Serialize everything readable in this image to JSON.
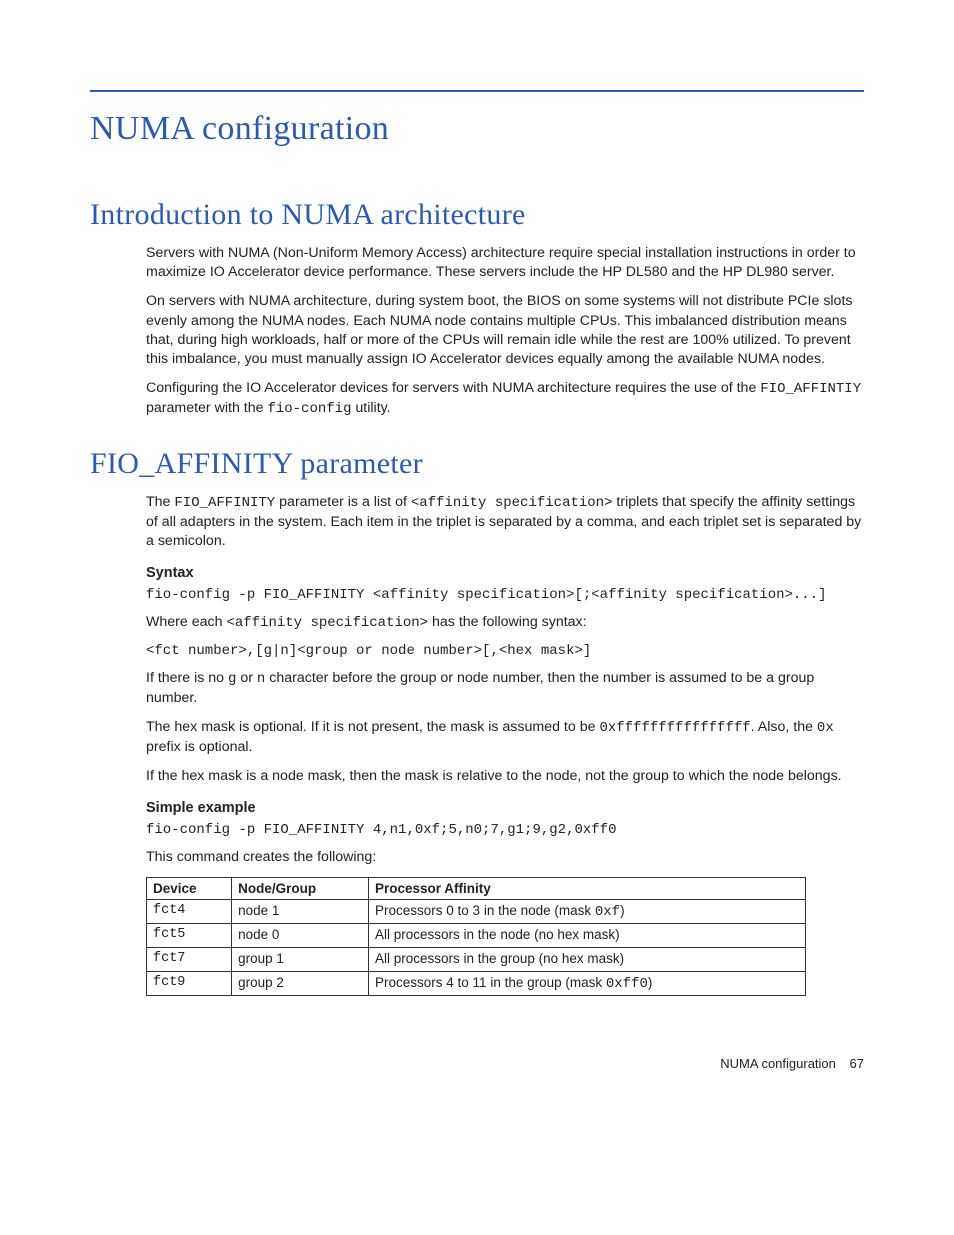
{
  "title": "NUMA configuration",
  "section1": {
    "heading": "Introduction to NUMA architecture",
    "para1": "Servers with NUMA (Non-Uniform Memory Access) architecture require special installation instructions in order to maximize IO Accelerator device performance. These servers include the HP DL580 and the HP DL980 server.",
    "para2": "On servers with NUMA architecture, during system boot, the BIOS on some systems will not distribute PCIe slots evenly among the NUMA nodes. Each NUMA node contains multiple CPUs. This imbalanced distribution means that, during high workloads, half or more of the CPUs will remain idle while the rest are 100% utilized. To prevent this imbalance, you must manually assign IO Accelerator devices equally among the available NUMA nodes.",
    "para3_a": "Configuring the IO Accelerator devices for servers with NUMA architecture requires the use of the ",
    "para3_code1": "FIO_AFFINTIY",
    "para3_b": " parameter with the ",
    "para3_code2": "fio-config",
    "para3_c": " utility."
  },
  "section2": {
    "heading": "FIO_AFFINITY parameter",
    "para1_a": "The ",
    "para1_code1": "FIO_AFFINITY",
    "para1_b": " parameter is a list of ",
    "para1_code2": "<affinity specification>",
    "para1_c": " triplets that specify the affinity settings of all adapters in the system. Each item in the triplet is separated by a comma, and each triplet set is separated by a semicolon.",
    "syntax_label": "Syntax",
    "syntax_block": "fio-config -p FIO_AFFINITY <affinity specification>[;<affinity specification>...]",
    "where_a": "Where each ",
    "where_code": "<affinity specification>",
    "where_b": " has the following syntax:",
    "where_syntax": "<fct number>,[g|n]<group or node number>[,<hex mask>]",
    "gn_a": "If there is no ",
    "gn_code1": "g",
    "gn_b": " or ",
    "gn_code2": "n",
    "gn_c": " character before the group or node number, then the number is assumed to be a group number.",
    "hex_a": "The hex mask is optional. If it is not present, the mask is assumed to be ",
    "hex_code1": "0xffffffffffffffff",
    "hex_b": ". Also, the ",
    "hex_code2": "0x",
    "hex_c": " prefix is optional.",
    "nodemask": "If the hex mask is a node mask, then the mask is relative to the node, not the group to which the node belongs.",
    "example_label": "Simple example",
    "example_block": "fio-config -p FIO_AFFINITY 4,n1,0xf;5,n0;7,g1;9,g2,0xff0",
    "example_caption": "This command creates the following:",
    "table": {
      "headers": [
        "Device",
        "Node/Group",
        "Processor Affinity"
      ],
      "rows": [
        {
          "device": "fct4",
          "group": "node 1",
          "aff_a": "Processors 0 to 3 in the node (mask ",
          "aff_code": "0xf",
          "aff_b": ")"
        },
        {
          "device": "fct5",
          "group": "node 0",
          "aff_a": "All processors in the node (no hex mask)",
          "aff_code": "",
          "aff_b": ""
        },
        {
          "device": "fct7",
          "group": "group 1",
          "aff_a": "All processors in the group (no hex mask)",
          "aff_code": "",
          "aff_b": ""
        },
        {
          "device": "fct9",
          "group": "group 2",
          "aff_a": "Processors 4 to 11 in the group (mask ",
          "aff_code": "0xff0",
          "aff_b": ")"
        }
      ]
    }
  },
  "footer": {
    "text": "NUMA configuration",
    "page": "67"
  }
}
